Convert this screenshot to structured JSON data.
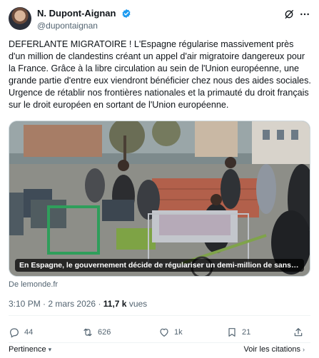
{
  "author": {
    "display_name": "N. Dupont-Aignan",
    "handle": "@dupontaignan"
  },
  "tweet": {
    "text": "DEFERLANTE MIGRATOIRE ! L'Espagne régularise massivement près d'un million de clandestins créant un appel d'air migratoire dangereux pour la France. Grâce à la libre circulation au sein de l'Union européenne, une grande partie d'entre eux viendront bénéficier chez nous des aides sociales. Urgence de rétablir nos frontières nationales et la primauté du droit français sur le droit européen en sortant de l'Union européenne."
  },
  "media": {
    "caption": "En Espagne, le gouvernement décide de régulariser un demi-million de sans-papiers p...",
    "source": "De lemonde.fr"
  },
  "meta": {
    "time": "3:10 PM",
    "separator": "·",
    "date": "2 mars 2026",
    "views_count": "11,7 k",
    "views_label": "vues"
  },
  "actions": {
    "replies": "44",
    "reposts": "626",
    "likes": "1k",
    "bookmarks": "21"
  },
  "footer": {
    "relevance": "Pertinence",
    "quotes": "Voir les citations"
  },
  "icons": {
    "verified": "verified-badge-icon",
    "grok": "grok-icon",
    "more": "more-options-icon",
    "reply": "reply-icon",
    "repost": "repost-icon",
    "like": "heart-icon",
    "bookmark": "bookmark-icon",
    "share": "share-icon"
  },
  "colors": {
    "verified": "#1d9bf0",
    "secondary_text": "#536471",
    "primary_text": "#0f1419"
  }
}
